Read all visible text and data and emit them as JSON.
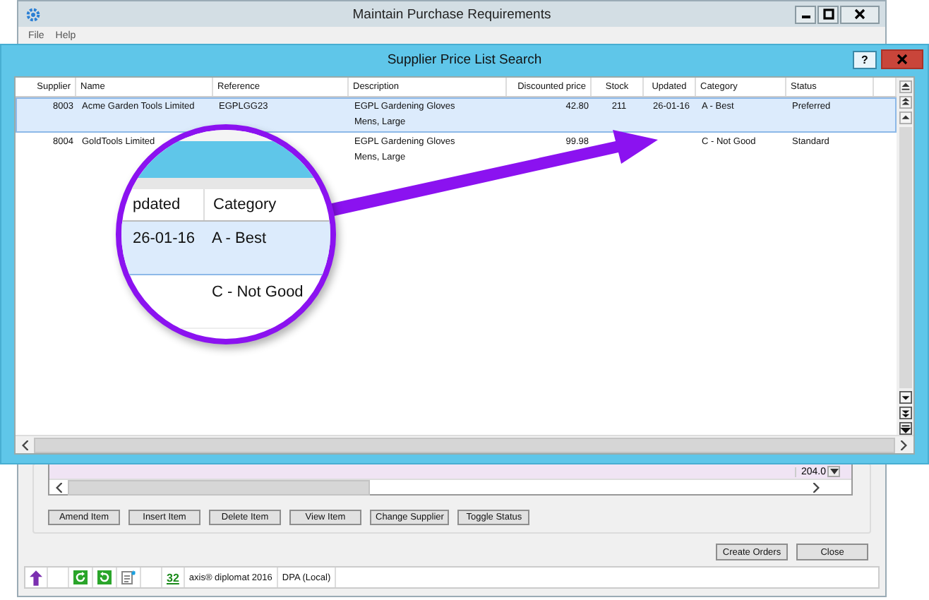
{
  "main_window": {
    "title": "Maintain Purchase Requirements",
    "menu": [
      "File",
      "Help"
    ],
    "grid_value": "204.0",
    "buttons": [
      "Amend Item",
      "Insert Item",
      "Delete Item",
      "View Item",
      "Change Supplier",
      "Toggle Status"
    ],
    "footer_buttons": [
      "Create Orders",
      "Close"
    ],
    "status_bar": {
      "count": "32",
      "product": "axis® diplomat 2016",
      "database": "DPA (Local)"
    }
  },
  "dialog": {
    "title": "Supplier Price List Search",
    "help": "?",
    "table": {
      "columns": [
        "Supplier",
        "Name",
        "Reference",
        "Description",
        "Discounted price",
        "Stock",
        "Updated",
        "Category",
        "Status"
      ],
      "rows": [
        {
          "supplier": "8003",
          "name": "Acme Garden Tools Limited",
          "reference": "EGPLGG23",
          "description": "EGPL Gardening Gloves",
          "description_2": "Mens, Large",
          "price": "42.80",
          "stock": "211",
          "updated": "26-01-16",
          "category": "A - Best",
          "status": "Preferred",
          "selected": true
        },
        {
          "supplier": "8004",
          "name": "GoldTools Limited",
          "description": "EGPL Gardening Gloves",
          "description_2": "Mens, Large",
          "price": "99.98",
          "category": "C - Not Good",
          "status": "Standard",
          "selected": false
        }
      ]
    }
  },
  "magnifier": {
    "columns": [
      "pdated",
      "Category"
    ],
    "rows": [
      {
        "updated": "26-01-16",
        "category": "A - Best",
        "selected": true
      },
      {
        "category": "C - Not Good",
        "selected": false
      }
    ]
  }
}
